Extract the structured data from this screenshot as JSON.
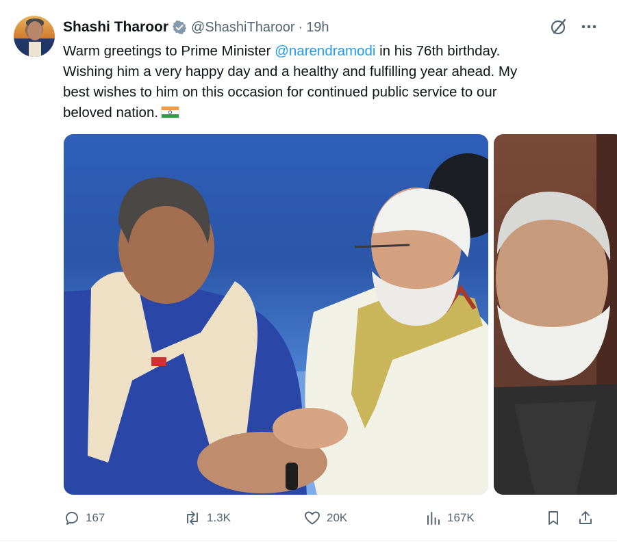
{
  "tweet": {
    "author_name": "Shashi Tharoor",
    "handle": "@ShashiTharoor",
    "separator": "·",
    "time": "19h",
    "text_line1_prefix": "Warm greetings to Prime Minister ",
    "text_line1_mention": "@narendramodi",
    "text_line1_suffix": " in his 76th birthday.",
    "text_line2": "Wishing him a very happy day and a healthy and fulfilling year ahead. My",
    "text_line3": "best wishes to him on this occasion for continued public service to our",
    "text_line4": "beloved nation.",
    "flag_icon": "india-flag-icon"
  },
  "actions": {
    "replies": "167",
    "reposts": "1.3K",
    "likes": "20K",
    "views": "167K"
  },
  "colors": {
    "accent": "#1d9bf0",
    "muted": "#536471",
    "verified": "#829aab"
  }
}
